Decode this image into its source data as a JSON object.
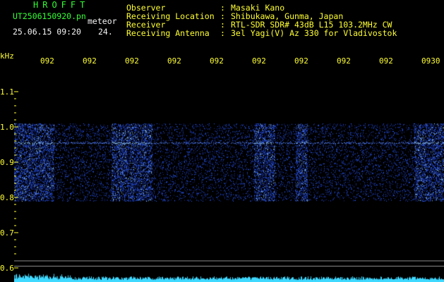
{
  "header": {
    "app_title": "HROFFT",
    "filename": "UT2506150920.pn",
    "mode_label": "meteor",
    "datetime": "25.06.15 09:20",
    "counter": "24."
  },
  "station": {
    "rows": [
      {
        "label": "Observer",
        "value": "Masaki Kano"
      },
      {
        "label": "Receiving Location",
        "value": "Shibukawa, Gunma, Japan"
      },
      {
        "label": "Receiver",
        "value": "RTL-SDR SDR# 43dB L15 103.2MHz CW"
      },
      {
        "label": "Receiving Antenna",
        "value": "3el Yagi(V) Az 330 for Vladivostok"
      }
    ],
    "colon": ":"
  },
  "axis": {
    "unit": "kHz",
    "y_ticks": [
      "1.1",
      "1.0",
      "0.9",
      "0.8",
      "0.7",
      "0.6"
    ],
    "x_ticks": [
      "092",
      "092",
      "092",
      "092",
      "092",
      "092",
      "092",
      "092",
      "092",
      "0930"
    ]
  },
  "spectrogram": {
    "freq_range_khz": [
      0.6,
      1.1
    ],
    "minutes": 10,
    "noise_band_khz": [
      0.79,
      1.01
    ],
    "carrier_khz": 0.955,
    "strong_segments_min": [
      [
        0,
        0.93
      ],
      [
        2.26,
        3.21
      ],
      [
        5.57,
        6.06
      ],
      [
        6.54,
        6.83
      ],
      [
        9.3,
        10
      ]
    ],
    "colors": {
      "background": "#000000",
      "signal": "#2a5cff",
      "speckle": "#9fd8ff",
      "baseline": "#3fd8ff",
      "axis": "#ffff33"
    }
  }
}
